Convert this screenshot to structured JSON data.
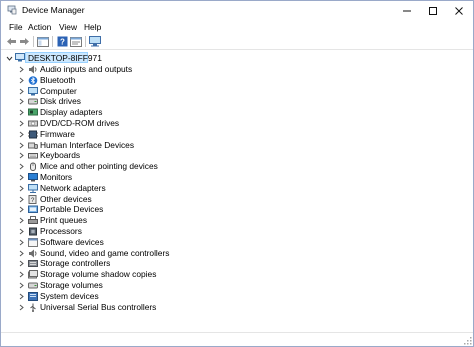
{
  "window": {
    "title": "Device Manager"
  },
  "menu": [
    "File",
    "Action",
    "View",
    "Help"
  ],
  "tree": {
    "root": "DESKTOP-8IFF971",
    "categories": [
      {
        "label": "Audio inputs and outputs",
        "icon": "speaker-icon"
      },
      {
        "label": "Bluetooth",
        "icon": "bluetooth-icon"
      },
      {
        "label": "Computer",
        "icon": "computer-icon"
      },
      {
        "label": "Disk drives",
        "icon": "disk-drive-icon"
      },
      {
        "label": "Display adapters",
        "icon": "display-adapter-icon"
      },
      {
        "label": "DVD/CD-ROM drives",
        "icon": "dvd-drive-icon"
      },
      {
        "label": "Firmware",
        "icon": "firmware-icon"
      },
      {
        "label": "Human Interface Devices",
        "icon": "hid-icon"
      },
      {
        "label": "Keyboards",
        "icon": "keyboard-icon"
      },
      {
        "label": "Mice and other pointing devices",
        "icon": "mouse-icon"
      },
      {
        "label": "Monitors",
        "icon": "monitor-icon"
      },
      {
        "label": "Network adapters",
        "icon": "network-adapter-icon"
      },
      {
        "label": "Other devices",
        "icon": "other-device-icon"
      },
      {
        "label": "Portable Devices",
        "icon": "portable-device-icon"
      },
      {
        "label": "Print queues",
        "icon": "printer-icon"
      },
      {
        "label": "Processors",
        "icon": "processor-icon"
      },
      {
        "label": "Software devices",
        "icon": "software-device-icon"
      },
      {
        "label": "Sound, video and game controllers",
        "icon": "sound-controller-icon"
      },
      {
        "label": "Storage controllers",
        "icon": "storage-controller-icon"
      },
      {
        "label": "Storage volume shadow copies",
        "icon": "shadow-copy-icon"
      },
      {
        "label": "Storage volumes",
        "icon": "storage-volume-icon"
      },
      {
        "label": "System devices",
        "icon": "system-device-icon"
      },
      {
        "label": "Universal Serial Bus controllers",
        "icon": "usb-icon"
      }
    ]
  }
}
